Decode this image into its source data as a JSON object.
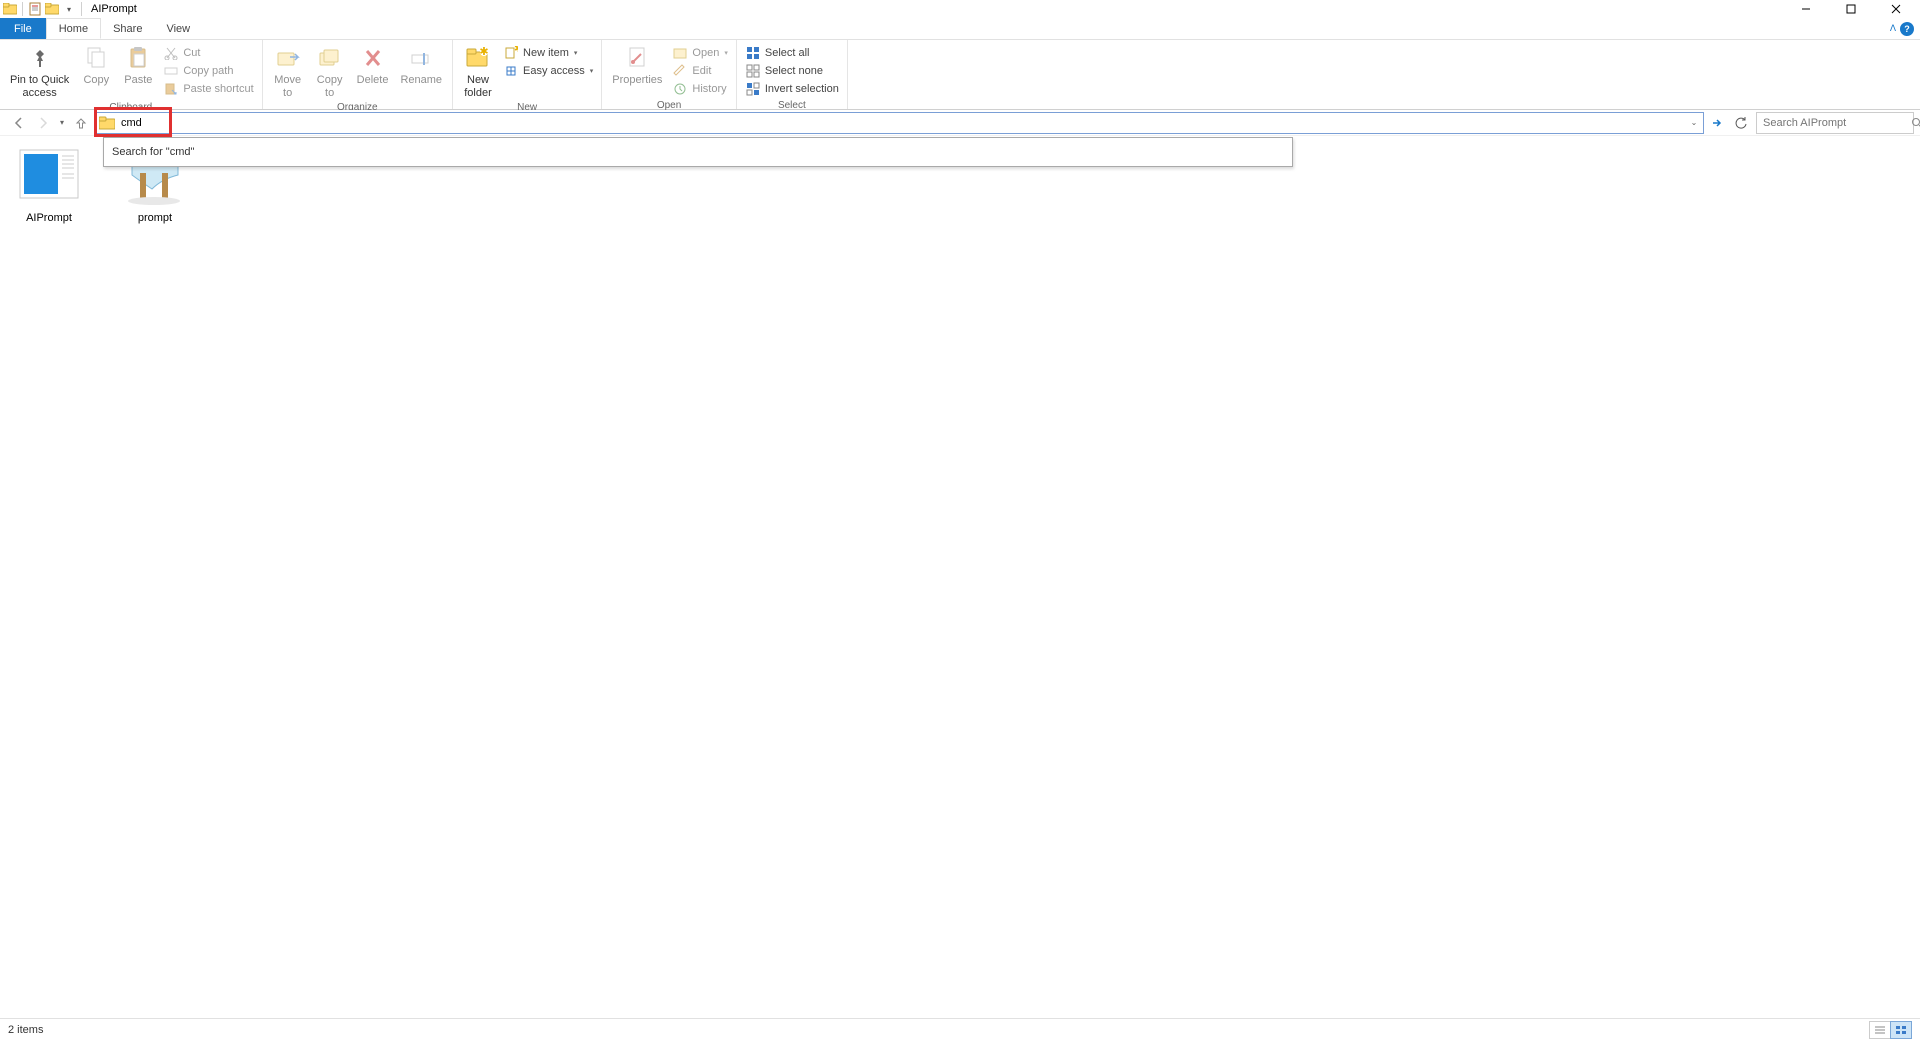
{
  "window": {
    "title": "AIPrompt"
  },
  "tabs": {
    "file": "File",
    "home": "Home",
    "share": "Share",
    "view": "View"
  },
  "ribbon": {
    "clipboard": {
      "label": "Clipboard",
      "pin": "Pin to Quick\naccess",
      "copy": "Copy",
      "paste": "Paste",
      "cut": "Cut",
      "copy_path": "Copy path",
      "paste_shortcut": "Paste shortcut"
    },
    "organize": {
      "label": "Organize",
      "move_to": "Move\nto",
      "copy_to": "Copy\nto",
      "delete": "Delete",
      "rename": "Rename"
    },
    "newgrp": {
      "label": "New",
      "new_folder": "New\nfolder",
      "new_item": "New item",
      "easy_access": "Easy access"
    },
    "open": {
      "label": "Open",
      "properties": "Properties",
      "open": "Open",
      "edit": "Edit",
      "history": "History"
    },
    "select": {
      "label": "Select",
      "select_all": "Select all",
      "select_none": "Select none",
      "invert": "Invert selection"
    }
  },
  "nav": {
    "address_value": "cmd",
    "search_placeholder": "Search AIPrompt",
    "dropdown_search": "Search for \"cmd\""
  },
  "items": [
    {
      "name": "AIPrompt"
    },
    {
      "name": "prompt"
    }
  ],
  "status": {
    "count": "2 items"
  }
}
